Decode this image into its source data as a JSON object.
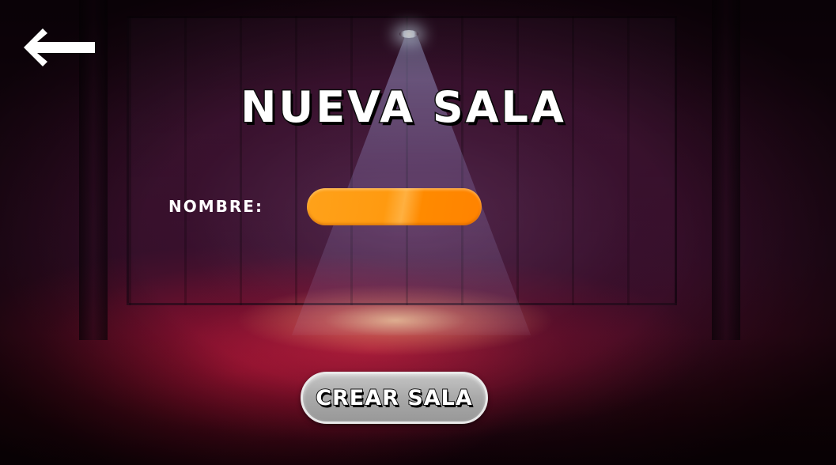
{
  "screen": {
    "title": "NUEVA SALA",
    "back_icon": "arrow-left-icon"
  },
  "form": {
    "name_label": "NOMBRE:",
    "name_value": "",
    "name_placeholder": ""
  },
  "actions": {
    "create_label": "CREAR SALA"
  },
  "colors": {
    "input_fill": "#ff9a10",
    "button_fill": "#a9a9a9",
    "title_text": "#ffffff",
    "text_outline": "#111111"
  }
}
